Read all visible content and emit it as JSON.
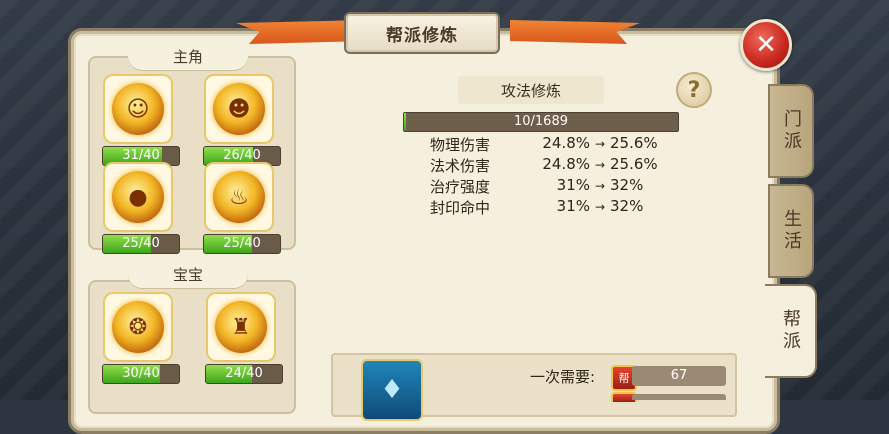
{
  "header": {
    "title": "帮派修炼"
  },
  "left": {
    "main_title": "主角",
    "pet_title": "宝宝",
    "main_skills": [
      {
        "label": "31/40",
        "progress": 0.775
      },
      {
        "label": "26/40",
        "progress": 0.65
      },
      {
        "label": "25/40",
        "progress": 0.625
      },
      {
        "label": "25/40",
        "progress": 0.625
      }
    ],
    "pet_skills": [
      {
        "label": "30/40",
        "progress": 0.75
      },
      {
        "label": "24/40",
        "progress": 0.6
      }
    ]
  },
  "detail": {
    "title": "攻法修炼",
    "help": "?",
    "exp_label": "10/1689",
    "exp_progress": 0.006,
    "stats": [
      {
        "name": "物理伤害",
        "from": "24.8%",
        "to": "25.6%"
      },
      {
        "name": "法术伤害",
        "from": "24.8%",
        "to": "25.6%"
      },
      {
        "name": "治疗强度",
        "from": "31%",
        "to": "32%"
      },
      {
        "name": "封印命中",
        "from": "31%",
        "to": "32%"
      }
    ],
    "arrow": "→"
  },
  "cost": {
    "label": "一次需要:",
    "badge": "帮",
    "value": "67"
  },
  "tabs": [
    {
      "label": "门派",
      "active": false
    },
    {
      "label": "生活",
      "active": false
    },
    {
      "label": "帮派",
      "active": true
    }
  ],
  "colors": {
    "accent": "#f2b524",
    "bar_green": "#3fa41a",
    "close_red": "#c7271d"
  }
}
